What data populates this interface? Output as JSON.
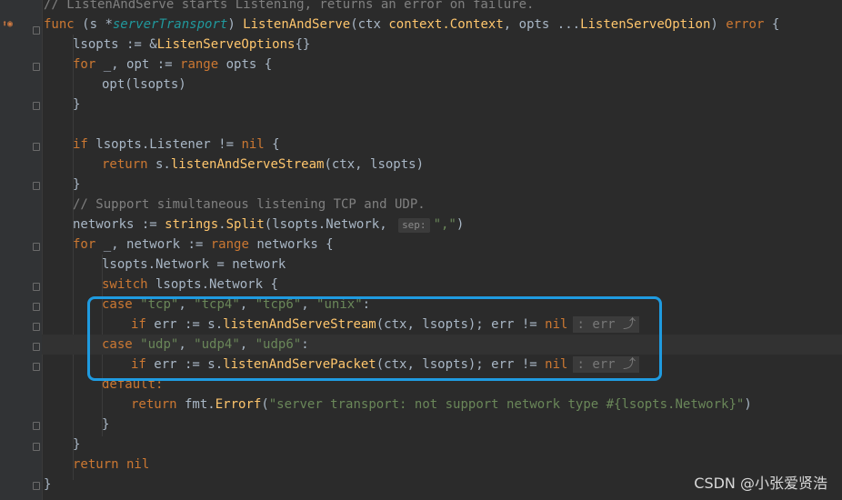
{
  "colors": {
    "background": "#2b2b2b",
    "keyword": "#cc7832",
    "function": "#ffc66d",
    "highlight_box": "#1f9be0"
  },
  "code": {
    "l0": "// ListenAndServe starts Listening, returns an error on failure.",
    "l1": {
      "func": "func",
      "recv": "(s *",
      "recvType": "serverTransport",
      "close": ") ",
      "name": "ListenAndServe",
      "p1": "(ctx ",
      "ctxType": "context.Context",
      "p2": ", opts ...",
      "optType": "ListenServeOption",
      "p3": ") ",
      "err": "error",
      "brace": " {"
    },
    "l2": {
      "a": "lsopts := &",
      "type": "ListenServeOptions",
      "b": "{}"
    },
    "l3": {
      "for": "for",
      "a": " _, opt := ",
      "range": "range",
      "b": " opts {"
    },
    "l4": "opt(lsopts)",
    "l5": "}",
    "l7": {
      "if": "if",
      "a": " lsopts.Listener != ",
      "nil": "nil",
      "b": " {"
    },
    "l8": {
      "return": "return",
      "s": " s.",
      "fn": "listenAndServeStream",
      "b": "(ctx, lsopts)"
    },
    "l9": "}",
    "l10": "// Support simultaneous listening TCP and UDP.",
    "l11": {
      "a": "networks := ",
      "pkg": "strings",
      "dot": ".",
      "fn": "Split",
      "b": "(lsopts.Network, ",
      "hint": "sep:",
      "str": "\",\"",
      "c": ")"
    },
    "l12": {
      "for": "for",
      "a": " _, network := ",
      "range": "range",
      "b": " networks {"
    },
    "l13": "lsopts.Network = network",
    "l14": {
      "switch": "switch",
      "a": " lsopts.Network {"
    },
    "l15": {
      "case": "case",
      "s1": "\"tcp\"",
      "s2": "\"tcp4\"",
      "s3": "\"tcp6\"",
      "s4": "\"unix\"",
      "sep": ", ",
      "colon": ":"
    },
    "l16": {
      "if": "if",
      "a": " err := s.",
      "fn": "listenAndServeStream",
      "b": "(ctx, lsopts); err != ",
      "nil": "nil",
      "hint": ": err"
    },
    "l17": {
      "case": "case",
      "s1": "\"udp\"",
      "s2": "\"udp4\"",
      "s3": "\"udp6\"",
      "sep": ", ",
      "colon": ":"
    },
    "l18": {
      "if": "if",
      "a": " err := s.",
      "fn": "listenAndServePacket",
      "b": "(ctx, lsopts); err != ",
      "nil": "nil",
      "hint": ": err"
    },
    "l19": "default:",
    "l20": {
      "return": "return",
      "pkg": " fmt.",
      "fn": "Errorf",
      "a": "(",
      "str": "\"server transport: not support network type #{lsopts.Network}\"",
      "b": ")"
    },
    "l21": "}",
    "l22": "}",
    "l23": {
      "return": "return",
      "nil": " nil"
    },
    "l24": "}"
  },
  "watermark": "CSDN @小张爱贤浩"
}
